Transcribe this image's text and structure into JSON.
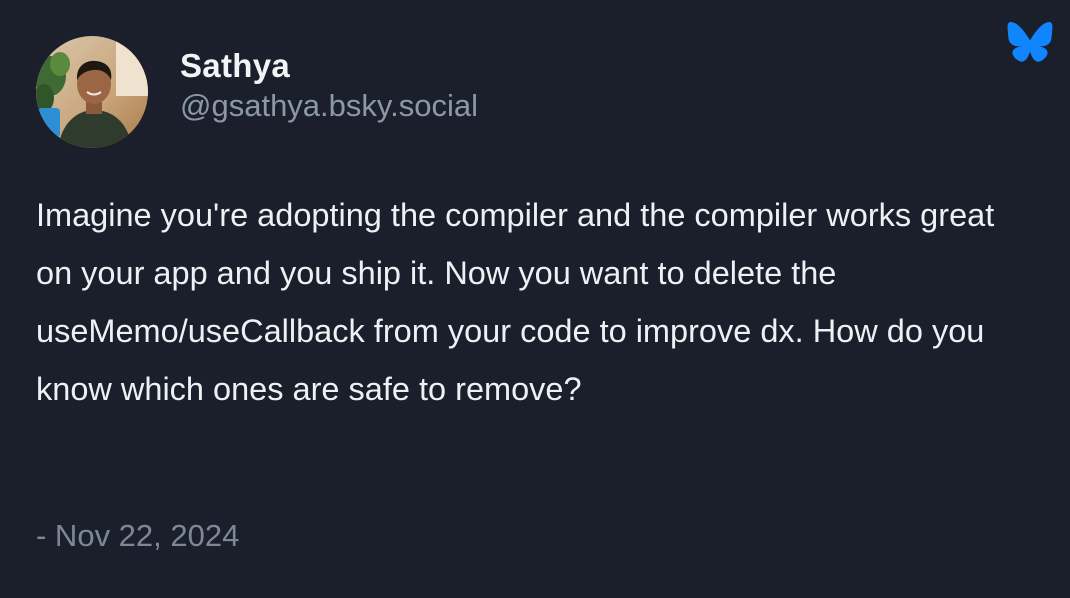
{
  "author": {
    "display_name": "Sathya",
    "handle": "@gsathya.bsky.social"
  },
  "post": {
    "text": "Imagine you're adopting the compiler and the compiler works great on your app and you ship it. Now you want to delete the useMemo/useCallback from your code to improve dx. How do you know which ones are safe to remove?",
    "timestamp": "- Nov 22, 2024"
  },
  "icons": {
    "logo": "bluesky-butterfly-icon"
  },
  "colors": {
    "background": "#1b1f2b",
    "text_primary": "#f1f3f5",
    "text_secondary": "#8b98a8",
    "brand_blue": "#1185fe"
  }
}
